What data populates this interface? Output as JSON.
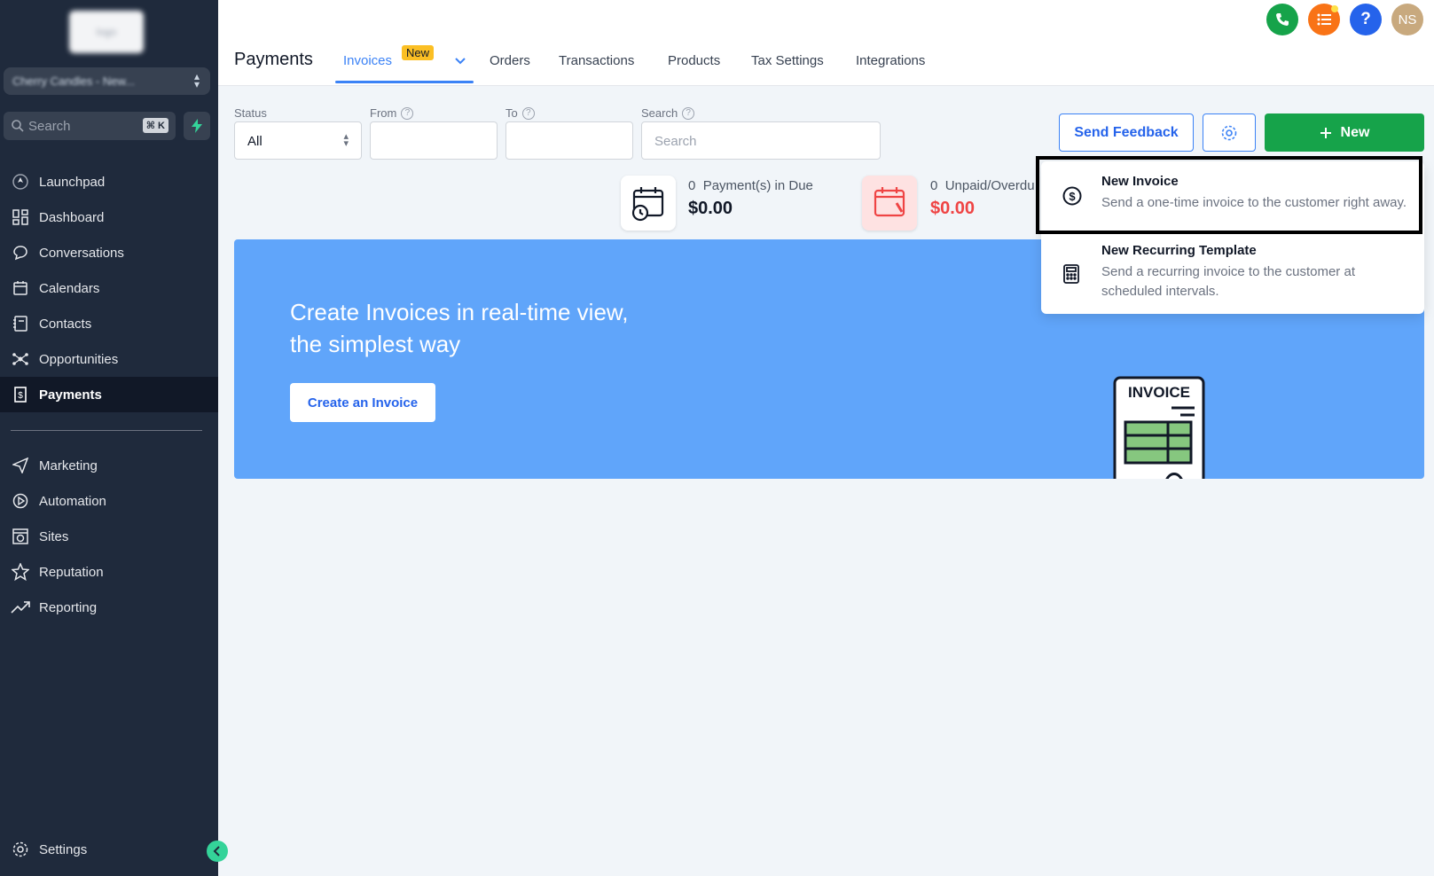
{
  "sidebar": {
    "logo_text": "logo",
    "account_name": "Cherry Candles - New...",
    "search_label": "Search",
    "search_shortcut": "⌘ K",
    "items": [
      {
        "label": "Launchpad"
      },
      {
        "label": "Dashboard"
      },
      {
        "label": "Conversations"
      },
      {
        "label": "Calendars"
      },
      {
        "label": "Contacts"
      },
      {
        "label": "Opportunities"
      },
      {
        "label": "Payments"
      },
      {
        "label": "Marketing"
      },
      {
        "label": "Automation"
      },
      {
        "label": "Sites"
      },
      {
        "label": "Reputation"
      },
      {
        "label": "Reporting"
      },
      {
        "label": "Settings"
      }
    ],
    "active_item": "Payments"
  },
  "header": {
    "title": "Payments",
    "tabs": [
      {
        "label": "Invoices"
      },
      {
        "label": "Orders"
      },
      {
        "label": "Transactions"
      },
      {
        "label": "Products"
      },
      {
        "label": "Tax Settings"
      },
      {
        "label": "Integrations"
      }
    ],
    "new_badge": "New",
    "avatar_initials": "NS",
    "help_label": "?"
  },
  "filters": {
    "status_label": "Status",
    "status_value": "All",
    "from_label": "From",
    "to_label": "To",
    "search_label": "Search",
    "search_placeholder": "Search"
  },
  "actions": {
    "feedback_label": "Send Feedback",
    "new_label": "New"
  },
  "stats": {
    "due_count": "0",
    "due_label": "Payment(s) in Due",
    "due_amount": "$0.00",
    "overdue_count": "0",
    "overdue_label": "Unpaid/Overdu",
    "overdue_amount": "$0.00"
  },
  "banner": {
    "title": "Create Invoices in real-time view, the simplest way",
    "button_label": "Create an Invoice",
    "art_label": "INVOICE"
  },
  "dropdown": {
    "items": [
      {
        "title": "New Invoice",
        "description": "Send a one-time invoice to the customer right away."
      },
      {
        "title": "New Recurring Template",
        "description": "Send a recurring invoice to the customer at scheduled intervals."
      }
    ]
  },
  "colors": {
    "sidebar_bg": "#1f2a3c",
    "accent_blue": "#3b82f6",
    "new_green": "#16a34a",
    "banner_blue": "#60a5fa",
    "overdue_red": "#ef4444"
  }
}
